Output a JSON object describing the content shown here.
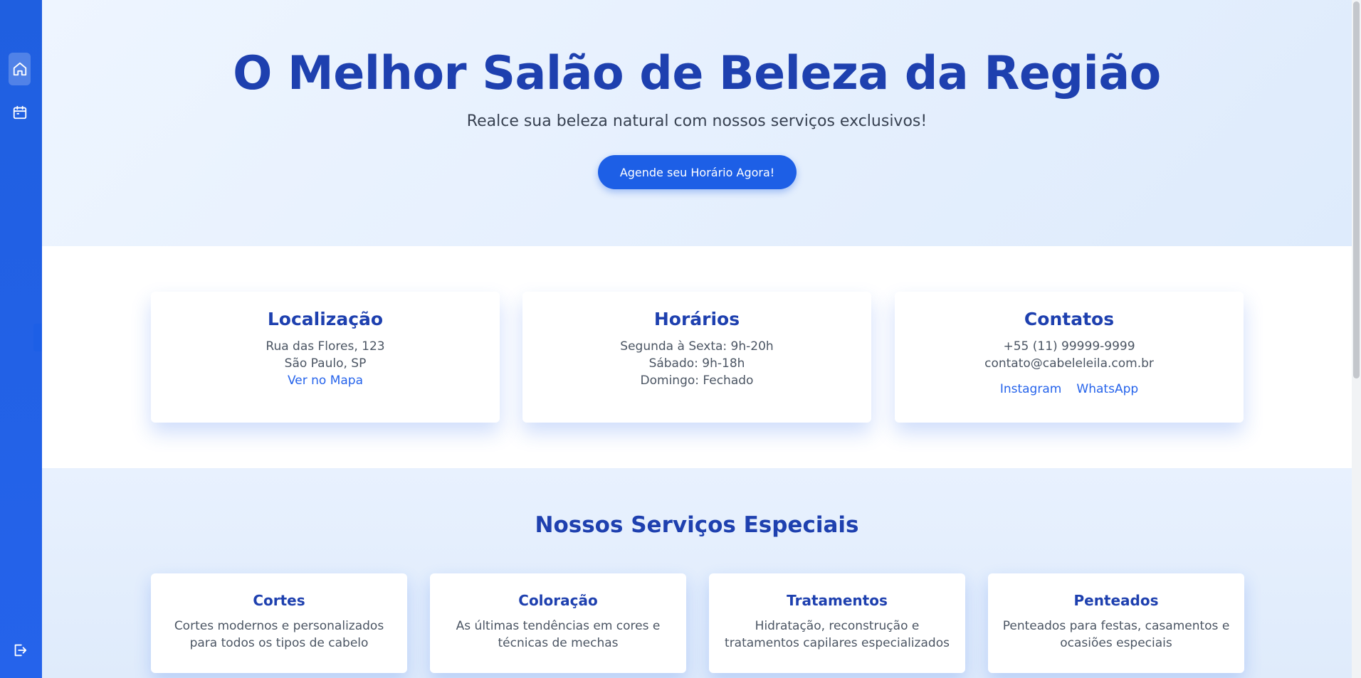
{
  "hero": {
    "title": "O Melhor Salão de Beleza da Região",
    "subtitle": "Realce sua beleza natural com nossos serviços exclusivos!",
    "cta_label": "Agende seu Horário Agora!"
  },
  "sidebar": {
    "items": [
      {
        "icon": "home-icon",
        "active": true
      },
      {
        "icon": "calendar-icon",
        "active": false
      }
    ],
    "footer_icon": "logout-icon",
    "collapse_icon": "chevron-left-icon"
  },
  "info_cards": [
    {
      "title": "Localização",
      "lines": [
        "Rua das Flores, 123",
        "São Paulo, SP"
      ],
      "link": "Ver no Mapa"
    },
    {
      "title": "Horários",
      "lines": [
        "Segunda à Sexta: 9h-20h",
        "Sábado: 9h-18h",
        "Domingo: Fechado"
      ]
    },
    {
      "title": "Contatos",
      "lines": [
        "+55 (11) 99999-9999",
        "contato@cabeleleila.com.br"
      ],
      "links": [
        "Instagram",
        "WhatsApp"
      ]
    }
  ],
  "services": {
    "title": "Nossos Serviços Especiais",
    "items": [
      {
        "title": "Cortes",
        "description": "Cortes modernos e personalizados para todos os tipos de cabelo"
      },
      {
        "title": "Coloração",
        "description": "As últimas tendências em cores e técnicas de mechas"
      },
      {
        "title": "Tratamentos",
        "description": "Hidratação, reconstrução e tratamentos capilares especializados"
      },
      {
        "title": "Penteados",
        "description": "Penteados para festas, casamentos e ocasiões especiais"
      }
    ]
  },
  "colors": {
    "primary": "#1d5fe6",
    "heading": "#1e40af",
    "sidebar": "#2563eb"
  }
}
